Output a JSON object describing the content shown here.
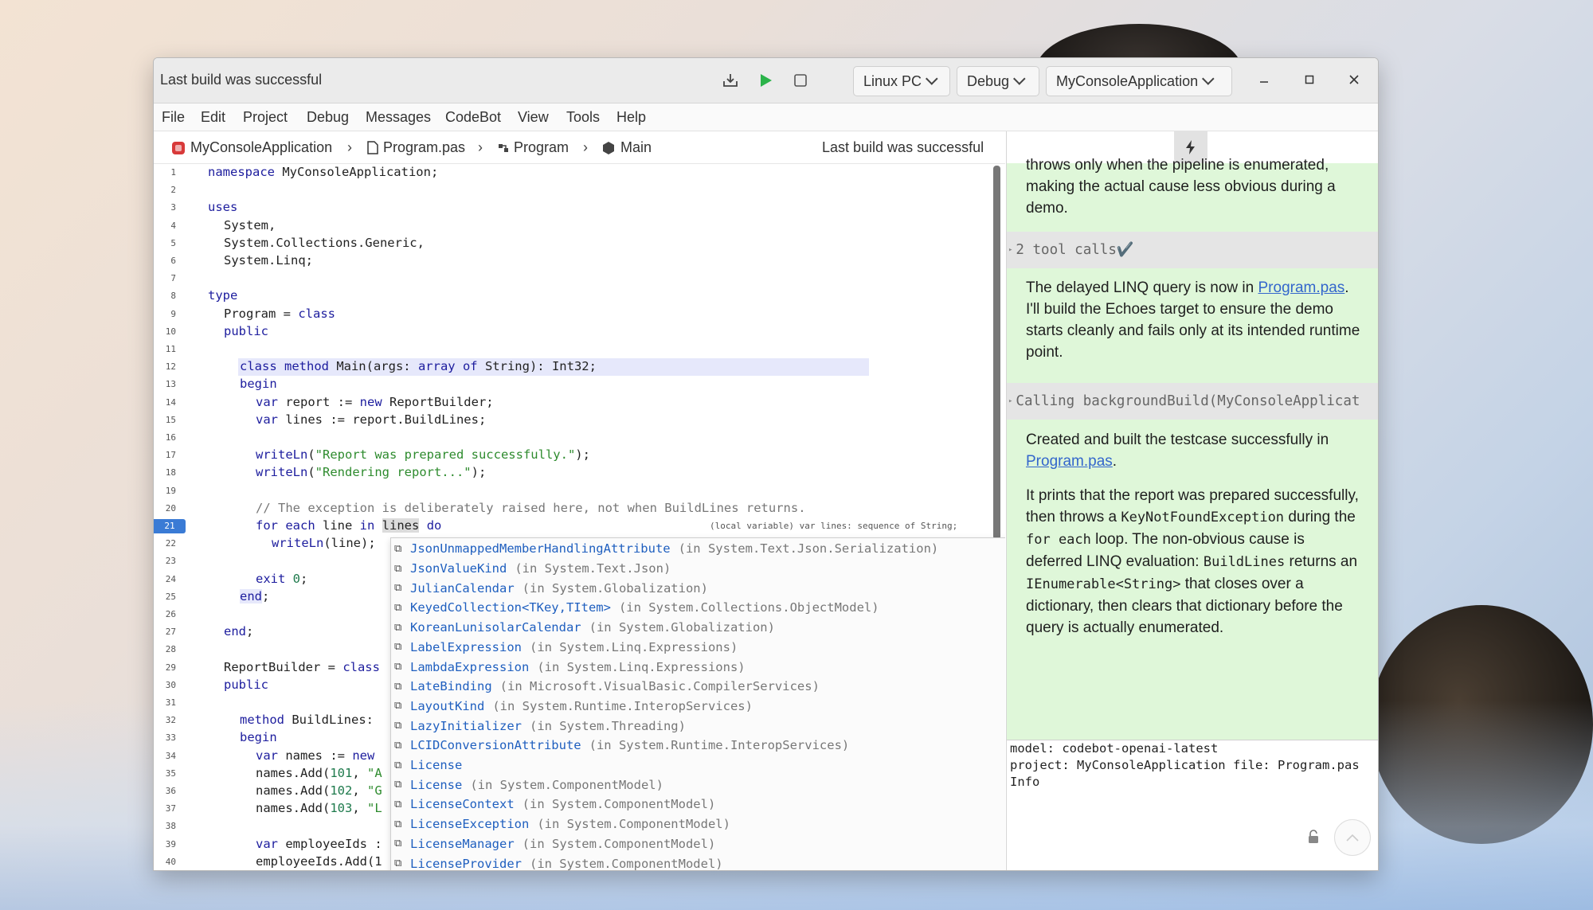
{
  "titlebar": {
    "status": "Last build was successful",
    "target_device": "Linux PC",
    "configuration": "Debug",
    "project": "MyConsoleApplication"
  },
  "menu": [
    "File",
    "Edit",
    "Project",
    "Debug",
    "Messages",
    "CodeBot",
    "View",
    "Tools",
    "Help"
  ],
  "breadcrumb": {
    "project": "MyConsoleApplication",
    "file": "Program.pas",
    "type": "Program",
    "method": "Main",
    "status": "Last build was successful"
  },
  "editor": {
    "active_line": 21,
    "hover_hint": "(local variable) var lines: sequence of String;",
    "lines": [
      {
        "n": "1",
        "text": "namespace MyConsoleApplication;"
      },
      {
        "n": "2",
        "text": ""
      },
      {
        "n": "3",
        "text": "uses"
      },
      {
        "n": "4",
        "text": "  System,"
      },
      {
        "n": "5",
        "text": "  System.Collections.Generic,"
      },
      {
        "n": "6",
        "text": "  System.Linq;"
      },
      {
        "n": "7",
        "text": ""
      },
      {
        "n": "8",
        "text": "type"
      },
      {
        "n": "9",
        "text": "  Program = class"
      },
      {
        "n": "10",
        "text": "  public"
      },
      {
        "n": "11",
        "text": ""
      },
      {
        "n": "12",
        "text": "    class method Main(args: array of String): Int32;"
      },
      {
        "n": "13",
        "text": "    begin"
      },
      {
        "n": "14",
        "text": "      var report := new ReportBuilder;"
      },
      {
        "n": "15",
        "text": "      var lines := report.BuildLines;"
      },
      {
        "n": "16",
        "text": ""
      },
      {
        "n": "17",
        "text": "      writeLn(\"Report was prepared successfully.\");"
      },
      {
        "n": "18",
        "text": "      writeLn(\"Rendering report...\");"
      },
      {
        "n": "19",
        "text": ""
      },
      {
        "n": "20",
        "text": "      // The exception is deliberately raised here, not when BuildLines returns."
      },
      {
        "n": "21",
        "text": "      for each line in lines do"
      },
      {
        "n": "22",
        "text": "        writeLn(line);"
      },
      {
        "n": "23",
        "text": ""
      },
      {
        "n": "24",
        "text": "      exit 0;"
      },
      {
        "n": "25",
        "text": "    end;"
      },
      {
        "n": "26",
        "text": ""
      },
      {
        "n": "27",
        "text": "  end;"
      },
      {
        "n": "28",
        "text": ""
      },
      {
        "n": "29",
        "text": "  ReportBuilder = class"
      },
      {
        "n": "30",
        "text": "  public"
      },
      {
        "n": "31",
        "text": ""
      },
      {
        "n": "32",
        "text": "    method BuildLines:"
      },
      {
        "n": "33",
        "text": "    begin"
      },
      {
        "n": "34",
        "text": "      var names := new"
      },
      {
        "n": "35",
        "text": "      names.Add(101, \"A"
      },
      {
        "n": "36",
        "text": "      names.Add(102, \"G"
      },
      {
        "n": "37",
        "text": "      names.Add(103, \"L"
      },
      {
        "n": "38",
        "text": ""
      },
      {
        "n": "39",
        "text": "      var employeeIds :"
      },
      {
        "n": "40",
        "text": "      employeeIds.Add(1"
      }
    ]
  },
  "completion": [
    {
      "name": "JsonUnmappedMemberHandlingAttribute",
      "ns": "(in System.Text.Json.Serialization)"
    },
    {
      "name": "JsonValueKind",
      "ns": "(in System.Text.Json)"
    },
    {
      "name": "JulianCalendar",
      "ns": "(in System.Globalization)"
    },
    {
      "name": "KeyedCollection<TKey,TItem>",
      "ns": "(in System.Collections.ObjectModel)"
    },
    {
      "name": "KoreanLunisolarCalendar",
      "ns": "(in System.Globalization)"
    },
    {
      "name": "LabelExpression",
      "ns": "(in System.Linq.Expressions)"
    },
    {
      "name": "LambdaExpression",
      "ns": "(in System.Linq.Expressions)"
    },
    {
      "name": "LateBinding",
      "ns": "(in Microsoft.VisualBasic.CompilerServices)"
    },
    {
      "name": "LayoutKind",
      "ns": "(in System.Runtime.InteropServices)"
    },
    {
      "name": "LazyInitializer",
      "ns": "(in System.Threading)"
    },
    {
      "name": "LCIDConversionAttribute",
      "ns": "(in System.Runtime.InteropServices)"
    },
    {
      "name": "License",
      "ns": ""
    },
    {
      "name": "License",
      "ns": "(in System.ComponentModel)"
    },
    {
      "name": "LicenseContext",
      "ns": "(in System.ComponentModel)"
    },
    {
      "name": "LicenseException",
      "ns": "(in System.ComponentModel)"
    },
    {
      "name": "LicenseManager",
      "ns": "(in System.ComponentModel)"
    },
    {
      "name": "LicenseProvider",
      "ns": "(in System.ComponentModel)"
    }
  ],
  "chat": {
    "msg1_text": "throws only when the pipeline is enumerated, making the actual cause less obvious during a demo.",
    "tool1": "2 tool calls✔️",
    "msg2_pre": "The delayed LINQ query is now in ",
    "msg2_link": "Program.pas",
    "msg2_post": ". I'll build the Echoes target to ensure the demo starts cleanly and fails only at its intended runtime point.",
    "tool2": "Calling backgroundBuild(MyConsoleApplicat",
    "msg3_pre": "Created and built the testcase successfully in ",
    "msg3_link": "Program.pas",
    "msg3_post": ".",
    "msg4_a": "It prints that the report was prepared successfully, then throws a ",
    "msg4_code1": "KeyNotFoundException",
    "msg4_b": " during the ",
    "msg4_code2": "for each",
    "msg4_c": " loop. The non-obvious cause is deferred LINQ evaluation: ",
    "msg4_code3": "BuildLines",
    "msg4_d": " returns an ",
    "msg4_code4": "IEnumerable<String>",
    "msg4_e": " that closes over a dictionary, then clears that dictionary before the query is actually enumerated.",
    "meta_model_label": "model:",
    "meta_model": "codebot-openai-latest",
    "meta_project_label": "project:",
    "meta_project": "MyConsoleApplication",
    "meta_file_label": "file:",
    "meta_file": "Program.pas",
    "meta_info": "Info"
  }
}
